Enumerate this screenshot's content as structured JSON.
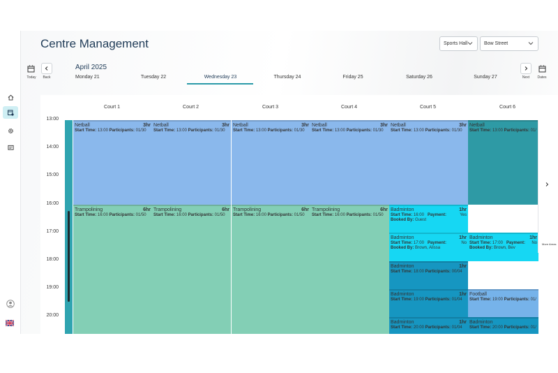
{
  "page": {
    "title": "Centre Management"
  },
  "filters": {
    "area": "Sports Hall",
    "site": "Bow Street"
  },
  "calendar": {
    "month": "April 2025",
    "today_label": "Today",
    "back_label": "Back",
    "next_label": "Next",
    "dates_label": "Dates",
    "days": [
      {
        "label": "Monday 21"
      },
      {
        "label": "Tuesday 22"
      },
      {
        "label": "Wednesday 23",
        "selected": true
      },
      {
        "label": "Thursday 24"
      },
      {
        "label": "Friday 25"
      },
      {
        "label": "Saturday 26"
      },
      {
        "label": "Sunday 27"
      }
    ],
    "more_areas_label": "More Areas"
  },
  "courts": [
    "Court 1",
    "Court 2",
    "Court 3",
    "Court 4",
    "Court 5",
    "Court 6"
  ],
  "times": [
    "13:00",
    "14:00",
    "15:00",
    "16:00",
    "17:00",
    "18:00",
    "19:00",
    "20:00"
  ],
  "events": [
    {
      "court": 1,
      "name": "Netball",
      "duration": "3hr",
      "start_time": "13:00",
      "participants": "01/30",
      "color": "#8ab8ec"
    },
    {
      "court": 2,
      "name": "Netball",
      "duration": "3hr",
      "start_time": "13:00",
      "participants": "01/30",
      "color": "#8ab8ec"
    },
    {
      "court": 3,
      "name": "Netball",
      "duration": "3hr",
      "start_time": "13:00",
      "participants": "01/30",
      "color": "#8ab8ec"
    },
    {
      "court": 4,
      "name": "Netball",
      "duration": "3hr",
      "start_time": "13:00",
      "participants": "01/30",
      "color": "#8ab8ec"
    },
    {
      "court": 5,
      "name": "Netball",
      "duration": "3hr",
      "start_time": "13:00",
      "participants": "01/30",
      "color": "#8ab8ec"
    },
    {
      "court": 6,
      "name": "Netball",
      "duration": "3hr",
      "start_time": "13:00",
      "participants": "01/",
      "color": "#2e9aa5"
    },
    {
      "court": 1,
      "name": "Trampolining",
      "duration": "6hr",
      "start_time": "16:00",
      "participants": "01/50",
      "color": "#83cfb5"
    },
    {
      "court": 2,
      "name": "Trampolining",
      "duration": "6hr",
      "start_time": "16:00",
      "participants": "01/50",
      "color": "#83cfb5"
    },
    {
      "court": 3,
      "name": "Trampolining",
      "duration": "6hr",
      "start_time": "16:00",
      "participants": "01/50",
      "color": "#83cfb5"
    },
    {
      "court": 4,
      "name": "Trampolining",
      "duration": "6hr",
      "start_time": "16:00",
      "participants": "01/50",
      "color": "#83cfb5"
    },
    {
      "court": 5,
      "name": "Badminton",
      "duration": "1hr",
      "start_time": "16:00",
      "payment": "Yes",
      "booked_by": "Guest",
      "color": "#16d7f3"
    },
    {
      "court": 5,
      "name": "Badminton",
      "duration": "1hr",
      "start_time": "17:00",
      "payment": "No",
      "booked_by": "Brown, Alissa",
      "color": "#16d7f3"
    },
    {
      "court": 6,
      "name": "Badminton",
      "duration": "1hr",
      "start_time": "17:00",
      "payment": "No",
      "booked_by": "Brown, Bev",
      "color": "#16d7f3"
    },
    {
      "court": 5,
      "name": "Badminton",
      "duration": "1hr",
      "start_time": "18:00",
      "participants": "00/04",
      "color": "#1696c1"
    },
    {
      "court": 5,
      "name": "Badminton",
      "duration": "1hr",
      "start_time": "19:00",
      "participants": "01/04",
      "color": "#1696c1"
    },
    {
      "court": 6,
      "name": "Football",
      "duration": "1hr",
      "start_time": "19:00",
      "participants": "01/",
      "color": "#76b3ea"
    },
    {
      "court": 5,
      "name": "Badminton",
      "duration": "1hr",
      "start_time": "20:00",
      "participants": "01/04",
      "color": "#1696c1"
    },
    {
      "court": 6,
      "name": "Badminton",
      "duration": "1hr",
      "start_time": "20:00",
      "participants": "01/",
      "color": "#1696c1"
    }
  ],
  "labels": {
    "start_time": "Start Time:",
    "participants": "Participants:",
    "payment": "Payment:",
    "booked_by": "Booked By:"
  },
  "icons": {
    "menu": "hamburger-icon",
    "home": "home-icon",
    "calendar_booking": "calendar-booking-icon",
    "settings": "gear-icon",
    "messages": "message-icon",
    "profile": "user-icon",
    "language": "uk-flag-icon"
  },
  "colors": {
    "accent": "#2a9aa8",
    "title": "#1f3b57"
  }
}
